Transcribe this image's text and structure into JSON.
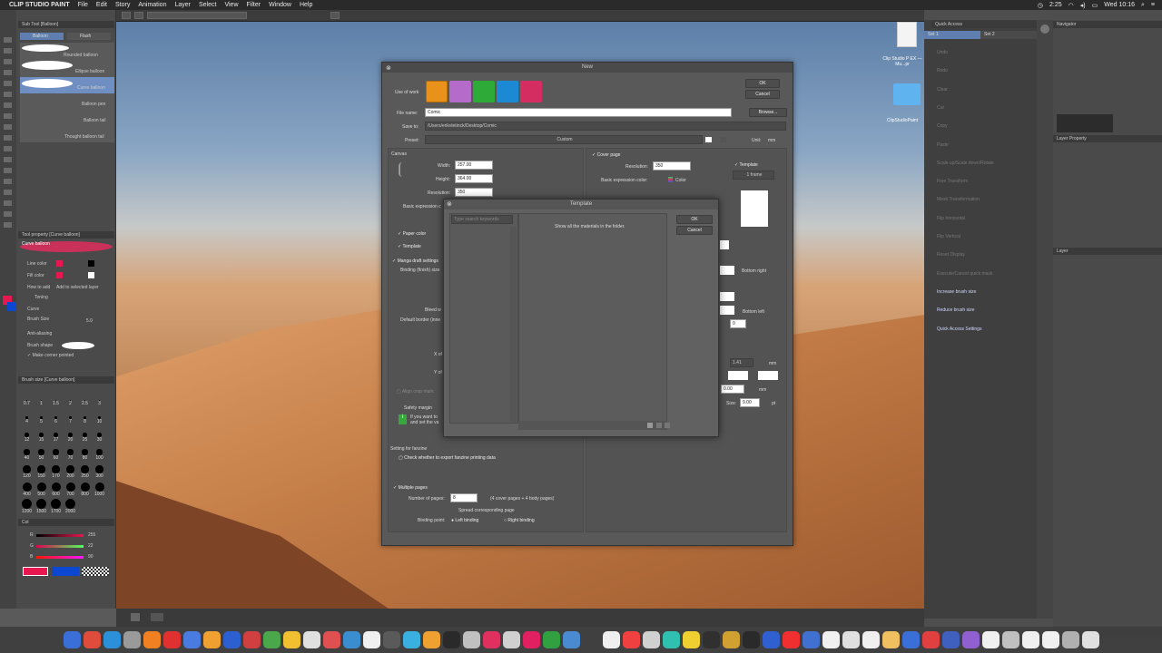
{
  "menubar": {
    "apple": "",
    "app": "CLIP STUDIO PAINT",
    "items": [
      "File",
      "Edit",
      "Story",
      "Animation",
      "Layer",
      "Select",
      "View",
      "Filter",
      "Window",
      "Help"
    ],
    "time": "2:25",
    "clock": "Wed 10:16"
  },
  "left_panel": {
    "subtool_header": "Sub Tool [Balloon]",
    "tabs": [
      "Balloon",
      "Flash"
    ],
    "subtools": [
      "Rounded balloon",
      "Ellipse balloon",
      "Curve balloon",
      "Balloon pen",
      "Balloon tail",
      "Thought balloon tail"
    ],
    "tool_property_header": "Tool property [Curve balloon]",
    "tool_property_name": "Curve balloon",
    "line_color": "Line color",
    "fill_color": "Fill color",
    "how_to_add": "How to add",
    "add_to_selected_layer": "Add to selected layer",
    "toning": "Toning",
    "curve": "Curve",
    "brush_size": "Brush Size",
    "brush_size_value": "5.0",
    "anti_aliasing": "Anti-aliasing",
    "brush_shape": "Brush shape",
    "make_corner_pointed": "Make corner pointed",
    "brush_size_header": "Brush size [Curve balloon]",
    "size_values": [
      "0.7",
      "1",
      "1.5",
      "2",
      "2.5",
      "3",
      "4",
      "5",
      "6",
      "7",
      "8",
      "10",
      "12",
      "15",
      "17",
      "20",
      "25",
      "30",
      "40",
      "50",
      "60",
      "70",
      "80",
      "100",
      "120",
      "150",
      "170",
      "200",
      "250",
      "300",
      "400",
      "500",
      "600",
      "700",
      "800",
      "1000",
      "1200",
      "1500",
      "1700",
      "2000"
    ],
    "color_header": "Col",
    "rgb": [
      {
        "ch": "R",
        "val": "255"
      },
      {
        "ch": "G",
        "val": "22"
      },
      {
        "ch": "B",
        "val": "90"
      }
    ],
    "accent_color": "#e8174f"
  },
  "right_panel": {
    "quick_access": "Quick Access",
    "sets": [
      "Set 1",
      "Set 2"
    ],
    "navigator": "Navigator",
    "layer_property": "Layer Property",
    "layer": "Layer",
    "items": [
      {
        "label": "Undo",
        "enabled": false
      },
      {
        "label": "Redo",
        "enabled": false
      },
      {
        "label": "Clear",
        "enabled": false
      },
      {
        "label": "Cut",
        "enabled": false
      },
      {
        "label": "Copy",
        "enabled": false
      },
      {
        "label": "Paste",
        "enabled": false
      },
      {
        "label": "Scale up/Scale down/Rotate",
        "enabled": false
      },
      {
        "label": "Free Transform",
        "enabled": false
      },
      {
        "label": "Mesh Transformation",
        "enabled": false
      },
      {
        "label": "Flip horizontal",
        "enabled": false
      },
      {
        "label": "Flip Vertical",
        "enabled": false
      },
      {
        "label": "Reset Display",
        "enabled": false
      },
      {
        "label": "Execute/Cancel quick mask",
        "enabled": false
      },
      {
        "label": "Increase brush size",
        "enabled": true
      },
      {
        "label": "Reduce brush size",
        "enabled": true
      },
      {
        "label": "Quick Access Settings",
        "enabled": true
      }
    ]
  },
  "desktop": {
    "file1": "Clip Studio P EX — Mu...pr",
    "file2": "ClipStudioPaint"
  },
  "new_dialog": {
    "title": "New",
    "ok": "OK",
    "cancel": "Cancel",
    "use_of_work": "Use of work",
    "file_name_label": "File name:",
    "file_name": "Comic",
    "browse": "Browse...",
    "save_to_label": "Save to:",
    "save_to": "/Users/erikvletinck/Desktop/Comic",
    "preset_label": "Preset:",
    "preset": "Custom",
    "unit_label": "Unit:",
    "unit": "mm",
    "canvas": "Canvas",
    "width_label": "Width:",
    "width": "257.00",
    "height_label": "Height:",
    "height": "364.00",
    "resolution_label": "Resolution:",
    "resolution": "350",
    "basic_expression": "Basic expression c",
    "paper_color": "Paper color",
    "template": "Template",
    "manga_draft": "Manga draft settings",
    "binding_size": "Binding (finish) size",
    "bleed": "Bleed w",
    "default_border": "Default border (inne",
    "align_crop": "Align crop mark",
    "safety_margin": "Safety margin",
    "if_you_want": "If you want to",
    "and_set": "and set the va",
    "fanzine_header": "Setting for fanzine",
    "fanzine_check": "Check whether to export fanzine printing data",
    "multiple_pages": "Multiple pages",
    "number_of_pages_label": "Number of pages:",
    "number_of_pages": "8",
    "pages_note": "(4 cover pages + 4 body pages)",
    "spread": "Spread corresponding page",
    "binding_point": "Binding point:",
    "left_binding": "Left binding",
    "right_binding": "Right binding",
    "cover_page": "Cover page",
    "cover_resolution_label": "Resolution:",
    "cover_resolution": "350",
    "cover_basic_expr": "Basic expression color:",
    "cover_color": "Color",
    "cover_template": "Template",
    "cover_template_value": "1 frame",
    "bottom_right": "Bottom right",
    "bottom_left": "Bottom left",
    "num_0": "0",
    "num_141": "1.41",
    "num_000": "0.00",
    "size_label": "Size:",
    "size_value": "9.00",
    "mm": "mm",
    "pt": "pt",
    "x_of": "X of",
    "y_of": "Y of"
  },
  "template_dialog": {
    "title": "Template",
    "search_placeholder": "Type search keywords",
    "message": "Show all the materials in the folder.",
    "ok": "OK",
    "cancel": "Cancel"
  }
}
